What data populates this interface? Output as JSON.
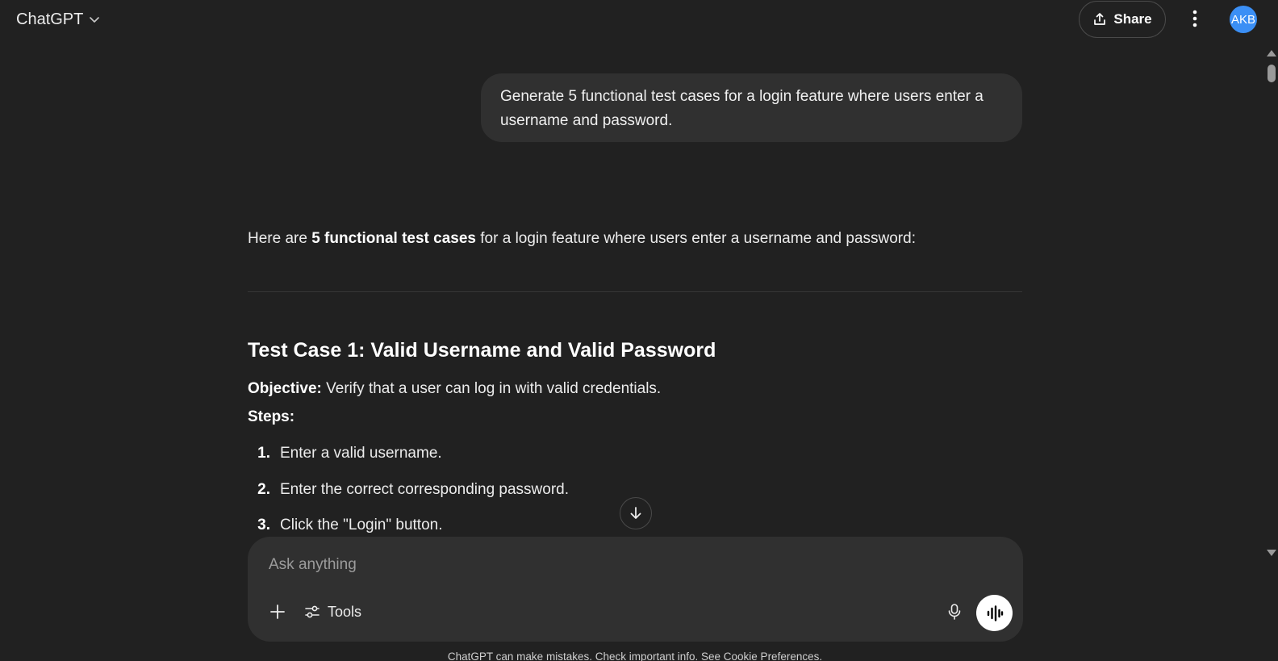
{
  "header": {
    "model_name": "ChatGPT",
    "share_label": "Share",
    "avatar_initials": "AKB"
  },
  "conversation": {
    "user_message": "Generate 5 functional test cases for a login feature where users enter a username and password.",
    "assistant": {
      "intro_prefix": "Here are ",
      "intro_bold": "5 functional test cases",
      "intro_suffix": " for a login feature where users enter a username and password:",
      "test_case_1": {
        "title_bold": "Test Case 1:",
        "title_rest": " Valid Username and Valid Password",
        "objective_label": "Objective:",
        "objective_text": " Verify that a user can log in with valid credentials.",
        "steps_label": "Steps:",
        "steps": [
          {
            "num": "1.",
            "text": "Enter a valid username."
          },
          {
            "num": "2.",
            "text": "Enter the correct corresponding password."
          },
          {
            "num": "3.",
            "text": "Click the \"Login\" button."
          }
        ]
      }
    }
  },
  "composer": {
    "placeholder": "Ask anything",
    "tools_label": "Tools"
  },
  "footer": {
    "disclaimer": "ChatGPT can make mistakes. Check important info. See Cookie Preferences."
  },
  "colors": {
    "background": "#212121",
    "bubble": "#303030",
    "avatar": "#3b8ff5"
  }
}
